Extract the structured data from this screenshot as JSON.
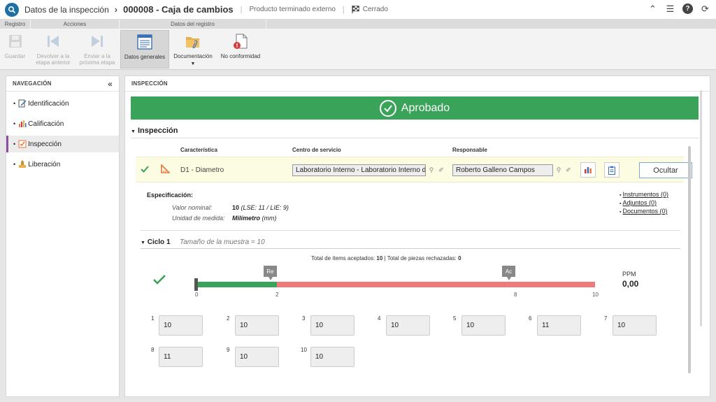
{
  "header": {
    "breadcrumb_1": "Datos de la inspección",
    "separator": "›",
    "breadcrumb_2": "000008 - Caja de cambios",
    "pipe": "|",
    "origin": "Producto terminado externo",
    "status": "Cerrado"
  },
  "ribbon": {
    "groups": [
      "Registro",
      "Acciones",
      "Datos del registro"
    ],
    "buttons": {
      "save": "Guardar",
      "return_line1": "Devolver a la",
      "return_line2": "etapa anterior",
      "send_line1": "Enviar a la",
      "send_line2": "próxima etapa",
      "general": "Datos generales",
      "docs": "Documentación",
      "nonconf": "No conformidad"
    }
  },
  "nav": {
    "title": "NAVEGACIÓN",
    "items": [
      {
        "label": "Identificación"
      },
      {
        "label": "Calificación"
      },
      {
        "label": "Inspección"
      },
      {
        "label": "Liberación"
      }
    ]
  },
  "main": {
    "title": "INSPECCIÓN",
    "banner": "Aprobado",
    "section": "Inspección",
    "columns": {
      "characteristic": "Característica",
      "service_center": "Centro de servicio",
      "responsible": "Responsable"
    },
    "row": {
      "characteristic": "D1 - Diametro",
      "service_center": "Laboratorio Interno - Laboratorio Interno de",
      "responsible": "Roberto Galleno Campos",
      "hide_button": "Ocultar"
    },
    "spec": {
      "title": "Especificación:",
      "nominal_label": "Valor nominal:",
      "nominal_value": "10",
      "nominal_limits": "(LSE: 11 / LIE: 9)",
      "unit_label": "Unidad de medida:",
      "unit_value": "Milímetro",
      "unit_abbr": "(mm)"
    },
    "links": [
      "Instrumentos (0)",
      "Adjuntos (0)",
      "Documentos (0)"
    ],
    "cycle": {
      "title": "Ciclo 1",
      "sample_size": "Tamaño de la muestra = 10",
      "totals_prefix": "Total de ítems aceptados:",
      "accepted": "10",
      "totals_mid": "| Total de piezas rechazadas:",
      "rejected": "0",
      "marker_re": "Re",
      "marker_ac": "Ac",
      "ticks": [
        "0",
        "2",
        "8",
        "10"
      ],
      "ppm_label": "PPM",
      "ppm_value": "0,00"
    },
    "samples": [
      {
        "n": "1",
        "v": "10"
      },
      {
        "n": "2",
        "v": "10"
      },
      {
        "n": "3",
        "v": "10"
      },
      {
        "n": "4",
        "v": "10"
      },
      {
        "n": "5",
        "v": "10"
      },
      {
        "n": "6",
        "v": "11"
      },
      {
        "n": "7",
        "v": "10"
      },
      {
        "n": "8",
        "v": "11"
      },
      {
        "n": "9",
        "v": "10"
      },
      {
        "n": "10",
        "v": "10"
      }
    ]
  },
  "colors": {
    "approved_green": "#3aa35a",
    "reject_red": "#ef7a7a",
    "active_nav": "#8a4f9e",
    "brand_blue": "#1d6fa5"
  }
}
